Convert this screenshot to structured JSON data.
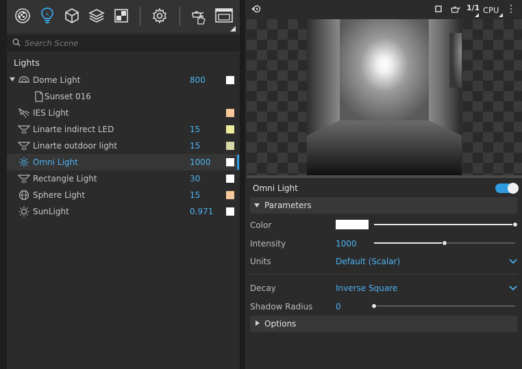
{
  "toolbar": {
    "buttons": [
      {
        "icon": "scene-icon"
      },
      {
        "icon": "lights-icon",
        "active": true
      },
      {
        "icon": "objects-icon"
      },
      {
        "icon": "layers-icon"
      },
      {
        "icon": "materials-icon"
      },
      {
        "icon": "settings-icon"
      },
      {
        "icon": "interactive-render-icon"
      },
      {
        "icon": "render-window-icon"
      }
    ]
  },
  "search": {
    "placeholder": "Search Scene"
  },
  "lights": {
    "header": "Lights",
    "items": [
      {
        "name": "Dome Light",
        "value": "800",
        "swatch": "#ffffff",
        "icon": "dome-light-icon",
        "expanded": true
      },
      {
        "name": "Sunset 016",
        "value": "",
        "swatch": "",
        "icon": "file-icon",
        "child": true
      },
      {
        "name": "IES Light",
        "value": "",
        "swatch": "#f6c89a",
        "icon": "ies-light-icon"
      },
      {
        "name": "Linarte indirect LED",
        "value": "15",
        "swatch": "#ecec9a",
        "icon": "spot-light-icon"
      },
      {
        "name": "Linarte outdoor light",
        "value": "15",
        "swatch": "#d8d8a6",
        "icon": "spot-light-icon"
      },
      {
        "name": "Omni Light",
        "value": "1000",
        "swatch": "#ffffff",
        "icon": "omni-light-icon",
        "selected": true
      },
      {
        "name": "Rectangle Light",
        "value": "30",
        "swatch": "#ffffff",
        "icon": "spot-light-icon"
      },
      {
        "name": "Sphere Light",
        "value": "15",
        "swatch": "#f6c89a",
        "icon": "sphere-light-icon"
      },
      {
        "name": "SunLight",
        "value": "0.971",
        "swatch": "#ffffff",
        "icon": "sun-light-icon"
      }
    ]
  },
  "viewport": {
    "resolution": "1/1",
    "device": "CPU"
  },
  "properties": {
    "title": "Omni Light",
    "enabled": true,
    "parameters_label": "Parameters",
    "color_label": "Color",
    "color_value": "#ffffff",
    "color_slider": 1.0,
    "intensity_label": "Intensity",
    "intensity_value": "1000",
    "intensity_slider": 0.5,
    "units_label": "Units",
    "units_value": "Default (Scalar)",
    "decay_label": "Decay",
    "decay_value": "Inverse Square",
    "shadow_radius_label": "Shadow Radius",
    "shadow_radius_value": "0",
    "shadow_radius_slider": 0.0,
    "options_label": "Options"
  },
  "colors": {
    "accent": "#2f9be0",
    "accent_text": "#4db3f0"
  }
}
